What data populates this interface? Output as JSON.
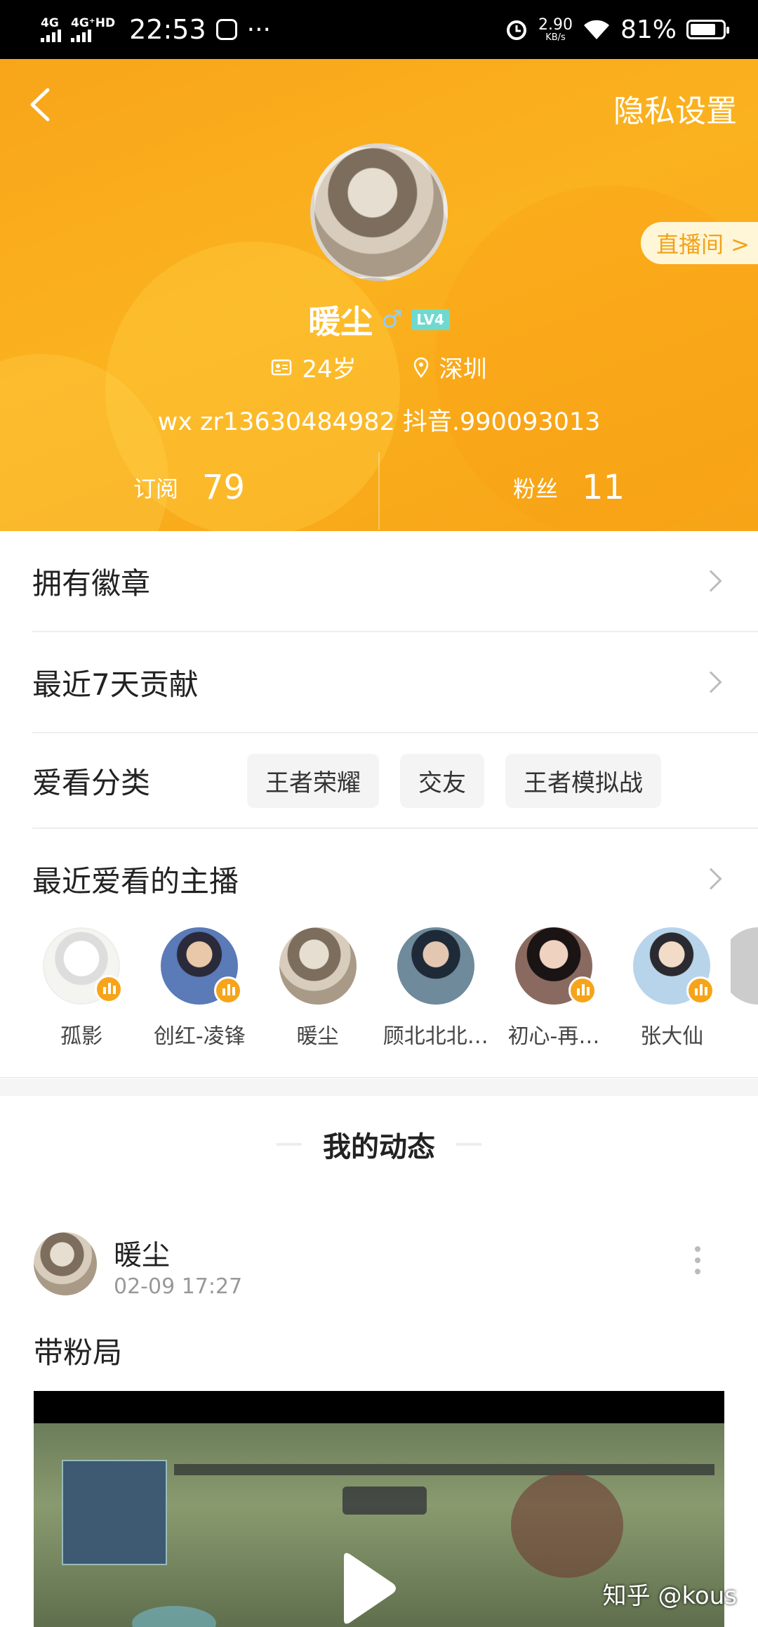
{
  "status_bar": {
    "network1": "4G",
    "network2": "4G⁺HD",
    "time": "22:53",
    "more": "···",
    "speed": "2.90",
    "speed_unit": "KB/s",
    "battery": "81%"
  },
  "header": {
    "privacy_label": "隐私设置",
    "live_label": "直播间 >",
    "name": "暖尘",
    "gender": "♂",
    "level": "LV4",
    "age": "24岁",
    "city": "深圳",
    "bio": "wx  zr13630484982 抖音.990093013",
    "subscribe_label": "订阅",
    "subscribe_count": "79",
    "fans_label": "粉丝",
    "fans_count": "11"
  },
  "menu": {
    "badges": "拥有徽章",
    "contribution": "最近7天贡献",
    "categories_label": "爱看分类",
    "categories": [
      "王者荣耀",
      "交友",
      "王者模拟战"
    ],
    "recent_anchors": "最近爱看的主播"
  },
  "anchors": [
    "孤影",
    "创红-凌锋",
    "暖尘",
    "顾北北北…",
    "初心-再…",
    "张大仙"
  ],
  "feed": {
    "title": "我的动态",
    "author": "暖尘",
    "time": "02-09 17:27",
    "text": "带粉局",
    "watermark": "知乎 @kous"
  },
  "colors": {
    "accent": "#f7a417",
    "badge": "#6fd9d0"
  }
}
